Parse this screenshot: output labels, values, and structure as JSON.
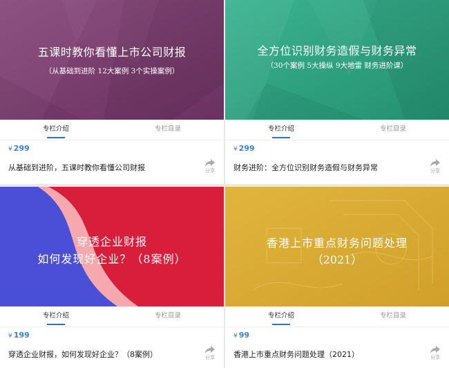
{
  "cards": [
    {
      "banner_title": "五课时教你看懂上市公司财报",
      "banner_subtitle": "（从基础到进阶  12大案例  3个实操案例）",
      "tab_intro": "专栏介绍",
      "tab_catalog": "专栏目录",
      "currency": "¥",
      "price": "299",
      "title": "从基础到进阶，五课时教你看懂公司财报",
      "share_label": "分享",
      "bg_color": "#7a3f6a"
    },
    {
      "banner_title": "全方位识别财务造假与财务异常",
      "banner_subtitle": "（30个案例 5大操纵 9大地雷 财务进阶课）",
      "tab_intro": "专栏介绍",
      "tab_catalog": "专栏目录",
      "currency": "¥",
      "price": "299",
      "title": "财务进阶：全方位识别财务造假与财务异常",
      "share_label": "分享",
      "bg_color": "#2fa383"
    },
    {
      "banner_title": "穿透企业财报",
      "banner_subtitle": "如何发现好企业？（8案例）",
      "tab_intro": "专栏介绍",
      "tab_catalog": "专栏目录",
      "currency": "¥",
      "price": "199",
      "title": "穿透企业财报，如何发现好企业？（8案例）",
      "share_label": "分享",
      "bg_color": "#d81e3a"
    },
    {
      "banner_title": "香港上市重点财务问题处理",
      "banner_subtitle": "（2021）",
      "tab_intro": "专栏介绍",
      "tab_catalog": "专栏目录",
      "currency": "¥",
      "price": "99",
      "title": "香港上市重点财务问题处理（2021）",
      "share_label": "分享",
      "bg_color": "#d9a82a"
    }
  ]
}
